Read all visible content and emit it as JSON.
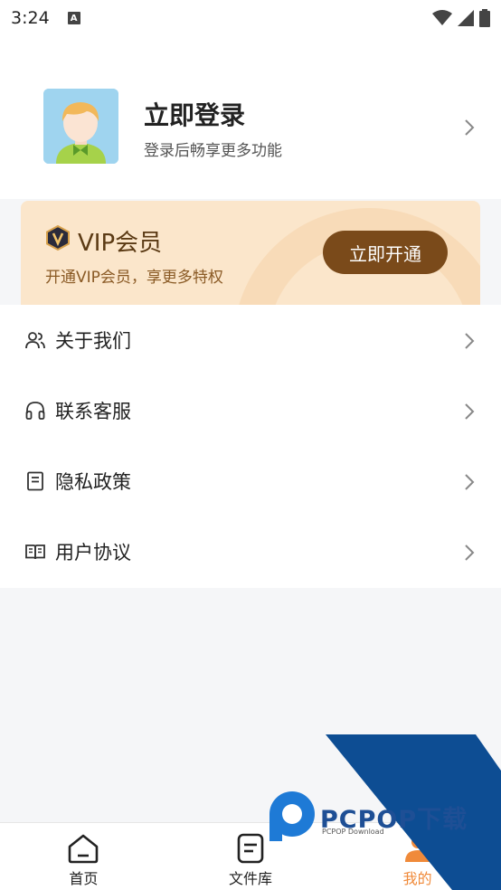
{
  "status_bar": {
    "time": "3:24",
    "notification_icon": "a-icon",
    "icons": [
      "wifi-icon",
      "signal-icon",
      "battery-icon"
    ]
  },
  "profile": {
    "title": "立即登录",
    "subtitle": "登录后畅享更多功能",
    "avatar_icon": "user-avatar"
  },
  "vip": {
    "title": "VIP会员",
    "subtitle": "开通VIP会员，享更多特权",
    "button_label": "立即开通",
    "colors": {
      "card": "#fbe6cb",
      "button": "#7a4a1a"
    }
  },
  "menu": {
    "items": [
      {
        "label": "关于我们",
        "icon": "users-icon"
      },
      {
        "label": "联系客服",
        "icon": "headset-icon"
      },
      {
        "label": "隐私政策",
        "icon": "document-icon"
      },
      {
        "label": "用户协议",
        "icon": "book-icon"
      }
    ]
  },
  "tabs": [
    {
      "label": "首页",
      "icon": "home-icon",
      "active": false
    },
    {
      "label": "文件库",
      "icon": "file-library-icon",
      "active": false
    },
    {
      "label": "我的",
      "icon": "profile-icon",
      "active": true
    }
  ],
  "watermark": {
    "brand": "PCPOP下载",
    "sub": "PCPOP Download"
  },
  "accent_color": "#f08a3a"
}
